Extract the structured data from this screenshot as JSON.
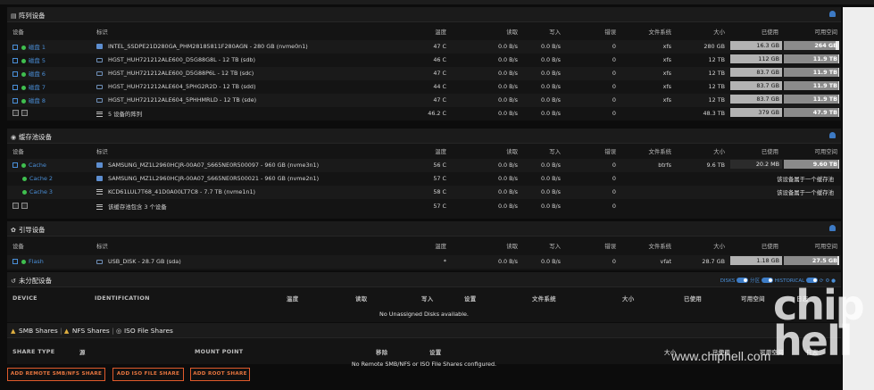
{
  "array": {
    "title": "阵列设备",
    "headers": {
      "device": "设备",
      "id": "标识",
      "temp": "温度",
      "reads": "读取",
      "writes": "写入",
      "errors": "错误",
      "fs": "文件系统",
      "size": "大小",
      "used": "已使用",
      "free": "可用空间"
    },
    "rows": [
      {
        "device": "磁盘 1",
        "id": "INTEL_SSDPE21D280GA_PHM28185811F280AGN - 280 GB (nvme0n1)",
        "temp": "47 C",
        "reads": "0.0 B/s",
        "writes": "0.0 B/s",
        "errors": "0",
        "fs": "xfs",
        "size": "280 GB",
        "used": "16.3 GB",
        "free": "264 GB",
        "free_pct": 94
      },
      {
        "device": "磁盘 5",
        "id": "HGST_HUH721212ALE600_D5G88G8L - 12 TB (sdb)",
        "temp": "46 C",
        "reads": "0.0 B/s",
        "writes": "0.0 B/s",
        "errors": "0",
        "fs": "xfs",
        "size": "12 TB",
        "used": "112 GB",
        "free": "11.9 TB",
        "free_pct": 99
      },
      {
        "device": "磁盘 6",
        "id": "HGST_HUH721212ALE600_D5G88P6L - 12 TB (sdc)",
        "temp": "47 C",
        "reads": "0.0 B/s",
        "writes": "0.0 B/s",
        "errors": "0",
        "fs": "xfs",
        "size": "12 TB",
        "used": "83.7 GB",
        "free": "11.9 TB",
        "free_pct": 99
      },
      {
        "device": "磁盘 7",
        "id": "HGST_HUH721212ALE604_5PHG2R2D - 12 TB (sdd)",
        "temp": "44 C",
        "reads": "0.0 B/s",
        "writes": "0.0 B/s",
        "errors": "0",
        "fs": "xfs",
        "size": "12 TB",
        "used": "83.7 GB",
        "free": "11.9 TB",
        "free_pct": 99
      },
      {
        "device": "磁盘 8",
        "id": "HGST_HUH721212ALE604_5PHHMRLD - 12 TB (sde)",
        "temp": "47 C",
        "reads": "0.0 B/s",
        "writes": "0.0 B/s",
        "errors": "0",
        "fs": "xfs",
        "size": "12 TB",
        "used": "83.7 GB",
        "free": "11.9 TB",
        "free_pct": 99
      }
    ],
    "summary": {
      "label": "5 设备的阵列",
      "temp": "46.2 C",
      "reads": "0.0 B/s",
      "writes": "0.0 B/s",
      "errors": "0",
      "size": "48.3 TB",
      "used": "379 GB",
      "free": "47.9 TB",
      "free_pct": 99
    }
  },
  "cache": {
    "title": "缓存池设备",
    "headers": {
      "device": "设备",
      "id": "标识",
      "temp": "温度",
      "reads": "读取",
      "writes": "写入",
      "errors": "错误",
      "fs": "文件系统",
      "size": "大小",
      "used": "已使用",
      "free": "可用空间"
    },
    "rows": [
      {
        "device": "Cache",
        "id": "SAMSUNG_MZ1L2960HCJR-00A07_S665NE0R500097 - 960 GB (nvme3n1)",
        "temp": "56 C",
        "reads": "0.0 B/s",
        "writes": "0.0 B/s",
        "errors": "0",
        "fs": "btrfs",
        "size": "9.6 TB",
        "used": "20.2 MB",
        "free": "9.60 TB",
        "free_pct": 99
      },
      {
        "device": "Cache 2",
        "id": "SAMSUNG_MZ1L2960HCJR-00A07_S665NE0R500021 - 960 GB (nvme2n1)",
        "temp": "57 C",
        "reads": "0.0 B/s",
        "writes": "0.0 B/s",
        "errors": "0",
        "note": "该设备属于一个缓存池"
      },
      {
        "device": "Cache 3",
        "id": "KCD61LUL7T68_41D0A00LT7C8 - 7.7 TB (nvme1n1)",
        "temp": "58 C",
        "reads": "0.0 B/s",
        "writes": "0.0 B/s",
        "errors": "0",
        "note": "该设备属于一个缓存池"
      }
    ],
    "summary": {
      "label": "该缓存池包含 3 个设备",
      "temp": "57 C",
      "reads": "0.0 B/s",
      "writes": "0.0 B/s",
      "errors": "0"
    }
  },
  "boot": {
    "title": "引导设备",
    "headers": {
      "device": "设备",
      "id": "标识",
      "temp": "温度",
      "reads": "读取",
      "writes": "写入",
      "errors": "错误",
      "fs": "文件系统",
      "size": "大小",
      "used": "已使用",
      "free": "可用空间"
    },
    "row": {
      "device": "Flash",
      "id": "USB_DISK - 28.7 GB (sda)",
      "temp": "*",
      "reads": "0.0 B/s",
      "writes": "0.0 B/s",
      "errors": "0",
      "fs": "vfat",
      "size": "28.7 GB",
      "used": "1.18 GB",
      "free": "27.5 GB",
      "free_pct": 96
    }
  },
  "unassigned": {
    "title": "未分配设备",
    "toggles": {
      "disks": "DISKS",
      "partitions": "分区",
      "historical": "HISTORICAL"
    },
    "headers": {
      "device": "DEVICE",
      "id": "IDENTIFICATION",
      "temp": "温度",
      "reads": "读取",
      "writes": "写入",
      "settings": "设置",
      "fs": "文件系统",
      "size": "大小",
      "used": "已使用",
      "free": "可用空间",
      "log": "日志"
    },
    "empty": "No Unassigned Disks available."
  },
  "shares": {
    "tabs": [
      "SMB Shares",
      "NFS Shares",
      "ISO File Shares"
    ],
    "headers": {
      "type": "SHARE TYPE",
      "source": "源",
      "mount": "MOUNT POINT",
      "remove": "移除",
      "settings": "设置",
      "size": "大小",
      "used": "已使用",
      "free": "可用空间",
      "log": "日志"
    },
    "empty": "No Remote SMB/NFS or ISO File Shares configured."
  },
  "buttons": {
    "add_remote": "ADD REMOTE SMB/NFS SHARE",
    "add_iso": "ADD ISO FILE SHARE",
    "add_root": "ADD ROOT SHARE"
  },
  "watermark": {
    "logo": "chip hell",
    "url": "www.chiphell.com"
  }
}
